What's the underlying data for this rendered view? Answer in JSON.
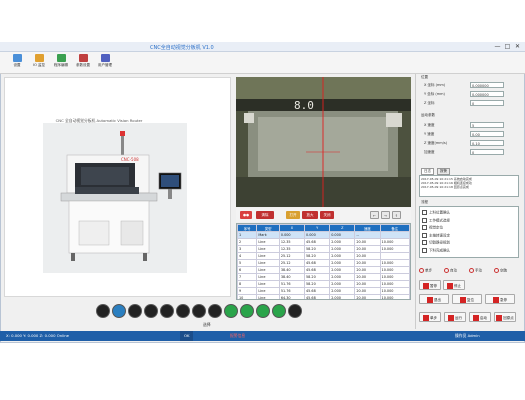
{
  "window": {
    "title": "CNC全自动视觉分板机 V1.0",
    "controls": [
      "—",
      "□",
      "✕"
    ]
  },
  "toolbar": {
    "items": [
      {
        "label": "设置",
        "icon": "settings-icon",
        "color": "#4a8fd8"
      },
      {
        "label": "IO 监控",
        "icon": "io-monitor-icon",
        "color": "#e0a030"
      },
      {
        "label": "程序编辑",
        "icon": "program-edit-icon",
        "color": "#3aa050"
      },
      {
        "label": "参数设置",
        "icon": "parameter-icon",
        "color": "#c04040"
      },
      {
        "label": "用户管理",
        "icon": "user-admin-icon",
        "color": "#5060c0"
      }
    ]
  },
  "machine": {
    "banner": "CNC 全自动视觉分板机 Automatic Vision Router",
    "brand": "CNC-508"
  },
  "camera": {
    "marking": "8.0"
  },
  "camera_controls": {
    "buttons": [
      {
        "label": "●●",
        "color": "#d94040"
      },
      {
        "label": "清除",
        "color": "#c03030"
      },
      {
        "label": "打开",
        "color": "#d9a030"
      },
      {
        "label": "放大",
        "color": "#c03030"
      },
      {
        "label": "关闭",
        "color": "#c03030"
      }
    ],
    "small": [
      "←",
      "→",
      "↑"
    ]
  },
  "table": {
    "headers": [
      "序号",
      "类型",
      "X",
      "Y",
      "Z",
      "速度",
      "备注"
    ],
    "rows": [
      [
        "1",
        "Mark",
        "0.000",
        "0.000",
        "0.000",
        "--",
        ""
      ],
      [
        "2",
        "Line",
        "12.35",
        "45.68",
        "2.000",
        "20.00",
        "10.000"
      ],
      [
        "3",
        "Line",
        "12.35",
        "58.20",
        "2.000",
        "20.00",
        "10.000"
      ],
      [
        "4",
        "Line",
        "25.12",
        "58.20",
        "2.000",
        "20.00",
        ""
      ],
      [
        "5",
        "Line",
        "25.12",
        "45.68",
        "2.000",
        "20.00",
        "10.000"
      ],
      [
        "6",
        "Line",
        "38.40",
        "45.68",
        "2.000",
        "20.00",
        "10.000"
      ],
      [
        "7",
        "Line",
        "38.40",
        "58.20",
        "2.000",
        "20.00",
        "10.000"
      ],
      [
        "8",
        "Line",
        "51.76",
        "58.20",
        "2.000",
        "20.00",
        "10.000"
      ],
      [
        "9",
        "Line",
        "51.76",
        "45.68",
        "2.000",
        "20.00",
        "10.000"
      ],
      [
        "10",
        "Line",
        "64.30",
        "45.68",
        "2.000",
        "20.00",
        "10.000"
      ],
      [
        "11",
        "Line",
        "64.30",
        "58.20",
        "2.000",
        "20.00",
        "10.000"
      ]
    ]
  },
  "bottom_tools": {
    "items": [
      {
        "icon": "gear-icon",
        "color": "#222"
      },
      {
        "icon": "drop-icon",
        "color": "#2b7fc0"
      },
      {
        "icon": "cup-icon",
        "color": "#222"
      },
      {
        "icon": "pill-icon",
        "color": "#222"
      },
      {
        "icon": "grid-icon",
        "color": "#222"
      },
      {
        "icon": "cross-icon",
        "color": "#222"
      },
      {
        "icon": "target-icon",
        "color": "#222"
      },
      {
        "icon": "split-icon",
        "color": "#222"
      },
      {
        "icon": "book-icon",
        "color": "#2aa44a"
      },
      {
        "icon": "phone-icon",
        "color": "#2aa44a"
      },
      {
        "icon": "lines-icon",
        "color": "#2aa44a"
      },
      {
        "icon": "sync-icon",
        "color": "#2aa44a"
      },
      {
        "icon": "link-icon",
        "color": "#222"
      }
    ],
    "caption": "选择"
  },
  "right": {
    "group1_title": "位置",
    "fields1": [
      {
        "label": "X 坐标 (mm)",
        "value": "0.000000"
      },
      {
        "label": "Y 坐标 (mm)",
        "value": "0.000000"
      },
      {
        "label": "Z 坐标",
        "value": "0"
      }
    ],
    "group2_title": "运动参数",
    "fields2": [
      {
        "label": "X 速度",
        "value": "5"
      },
      {
        "label": "Y 速度",
        "value": "0.00"
      },
      {
        "label": "Z 速度(mm/s)",
        "value": "0.10"
      },
      {
        "label": "加速度",
        "value": "0"
      }
    ],
    "tabs": [
      "日志",
      "报警"
    ],
    "log_lines": [
      "2017-05-09 10:21:15 系统启动完成",
      "2017-05-09 10:21:16 相机连接成功",
      "2017-05-09 10:21:18 回原点完成"
    ],
    "tree_title": "流程",
    "tree_items": [
      "上料位置确认",
      "工作模式选择",
      "视觉定位",
      "主轴转速设定",
      "切割路径规划",
      "下料完成确认"
    ],
    "mode_options": [
      "单步",
      "自动",
      "手动",
      "空跑"
    ],
    "buttons_row1": [
      "暂停",
      "停止"
    ],
    "buttons_row2": [
      "退出",
      "复位",
      "急停"
    ],
    "buttons_row3": [
      "单步",
      "运行",
      "启动",
      "回原点"
    ]
  },
  "status": {
    "left": "X: 0.000  Y: 0.000  Z: 0.000  Online",
    "mid": "OK",
    "alarm": "报警信息",
    "right": "操作员 Admin"
  }
}
